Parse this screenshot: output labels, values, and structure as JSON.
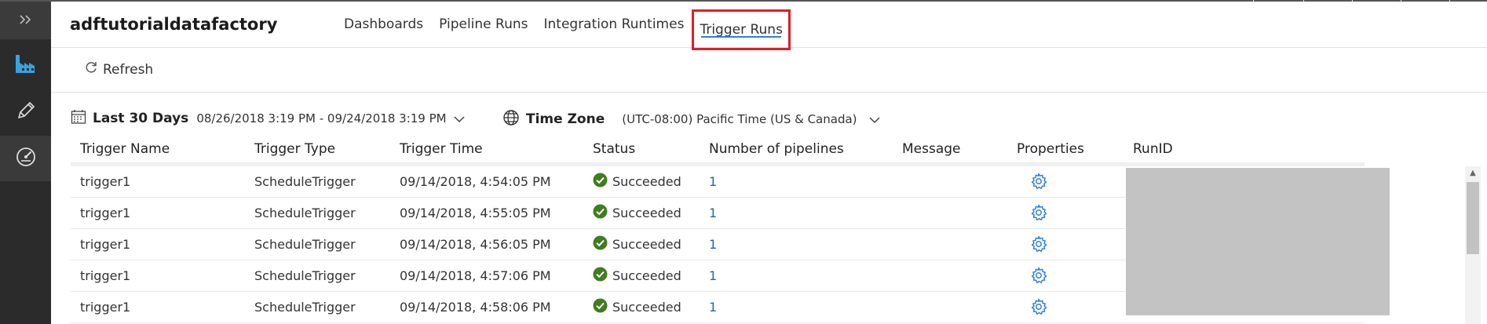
{
  "header": {
    "app_title": "adftutorialdatafactory",
    "nav": [
      {
        "label": "Dashboards"
      },
      {
        "label": "Pipeline Runs"
      },
      {
        "label": "Integration Runtimes"
      },
      {
        "label": "Trigger Runs"
      }
    ],
    "active_tab": "Trigger Runs"
  },
  "rail": {
    "icons": [
      "expand-chevrons-icon",
      "factory-icon",
      "pencil-icon",
      "monitor-gauge-icon"
    ]
  },
  "toolbar": {
    "refresh_label": "Refresh"
  },
  "filters": {
    "date_label": "Last 30 Days",
    "date_range": "08/26/2018 3:19 PM - 09/24/2018 3:19 PM",
    "timezone_label": "Time Zone",
    "timezone_value": "(UTC-08:00) Pacific Time (US & Canada)"
  },
  "table": {
    "columns": [
      "Trigger Name",
      "Trigger Type",
      "Trigger Time",
      "Status",
      "Number of pipelines",
      "Message",
      "Properties",
      "RunID"
    ],
    "rows": [
      {
        "name": "trigger1",
        "type": "ScheduleTrigger",
        "time": "09/14/2018, 4:54:05 PM",
        "status": "Succeeded",
        "pipelines": "1",
        "message": ""
      },
      {
        "name": "trigger1",
        "type": "ScheduleTrigger",
        "time": "09/14/2018, 4:55:05 PM",
        "status": "Succeeded",
        "pipelines": "1",
        "message": ""
      },
      {
        "name": "trigger1",
        "type": "ScheduleTrigger",
        "time": "09/14/2018, 4:56:05 PM",
        "status": "Succeeded",
        "pipelines": "1",
        "message": ""
      },
      {
        "name": "trigger1",
        "type": "ScheduleTrigger",
        "time": "09/14/2018, 4:57:06 PM",
        "status": "Succeeded",
        "pipelines": "1",
        "message": ""
      },
      {
        "name": "trigger1",
        "type": "ScheduleTrigger",
        "time": "09/14/2018, 4:58:06 PM",
        "status": "Succeeded",
        "pipelines": "1",
        "message": ""
      }
    ]
  },
  "colors": {
    "accent": "#2f7fdc",
    "highlight_box": "#e21d28",
    "success": "#3f7d1f",
    "link": "#1a66b8",
    "rail_bg": "#2b2b2b"
  }
}
